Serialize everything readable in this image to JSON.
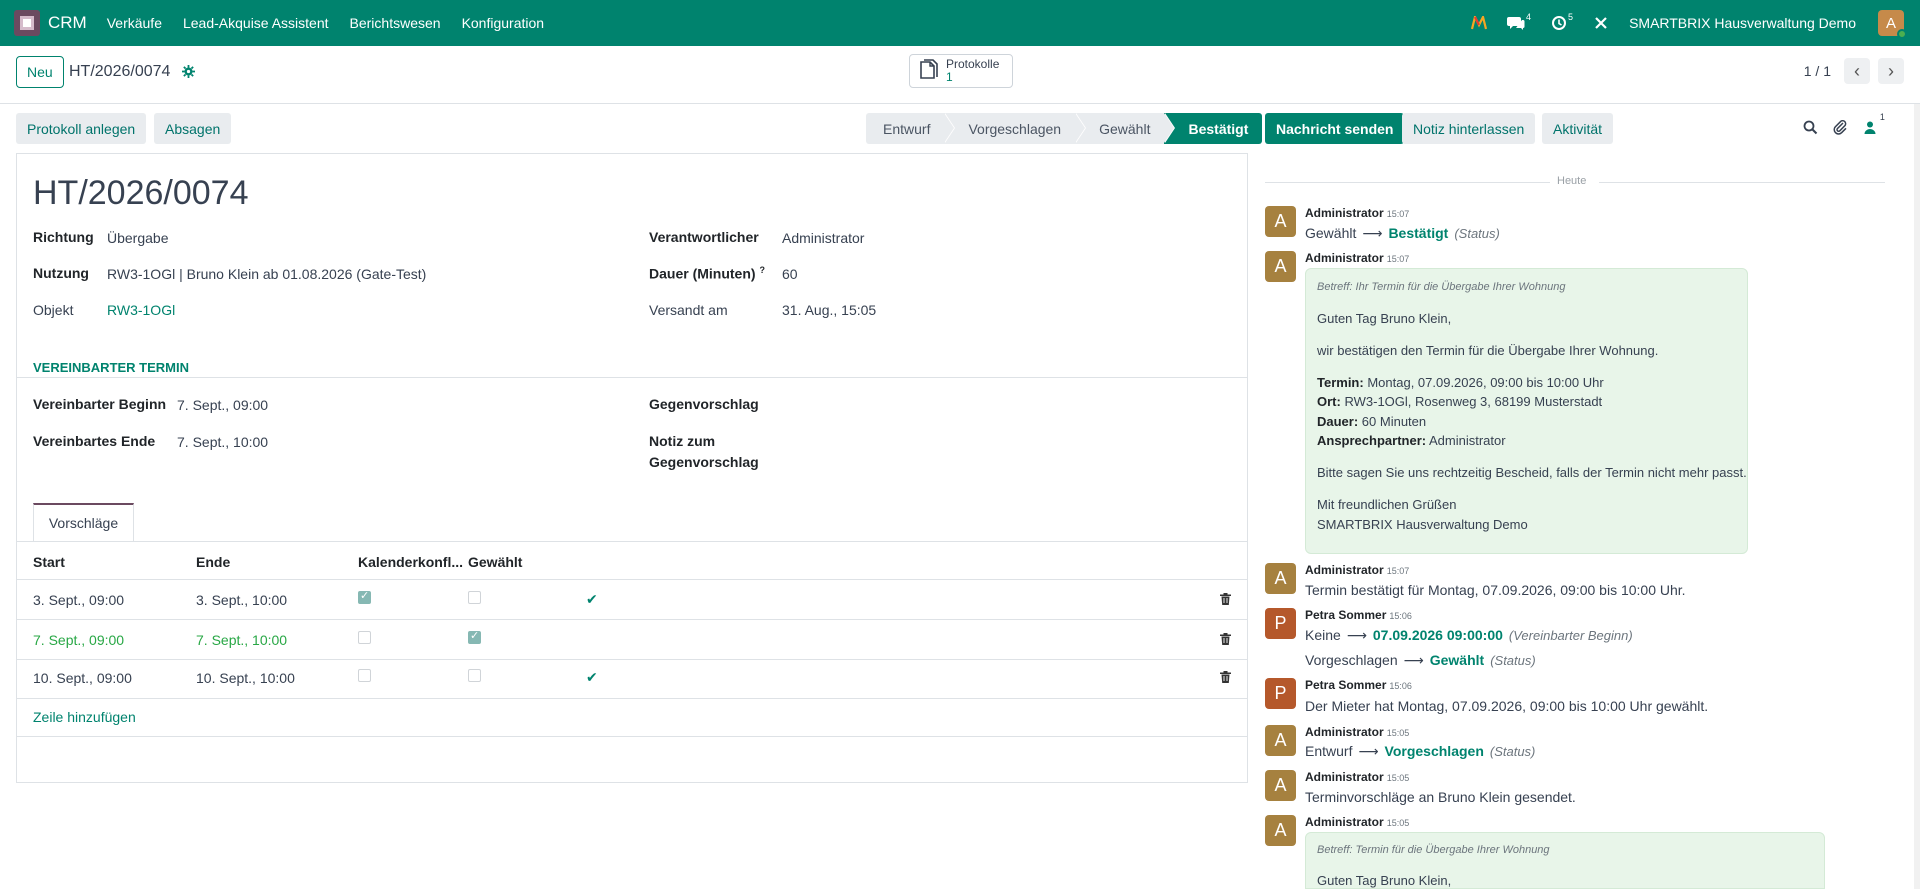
{
  "navbar": {
    "app_name": "CRM",
    "menu": [
      "Verkäufe",
      "Lead-Akquise Assistent",
      "Berichtswesen",
      "Konfiguration"
    ],
    "chat_count": "4",
    "activity_count": "5",
    "company": "SMARTBRIX Hausverwaltung Demo",
    "avatar_letter": "A"
  },
  "control": {
    "new_label": "Neu",
    "record_name": "HT/2026/0074",
    "smart_button": {
      "label": "Protokolle",
      "count": "1"
    },
    "pager": "1 / 1"
  },
  "actions": {
    "create_protocol": "Protokoll anlegen",
    "cancel": "Absagen"
  },
  "status": {
    "steps": [
      "Entwurf",
      "Vorgeschlagen",
      "Gewählt",
      "Bestätigt"
    ],
    "active": "Bestätigt"
  },
  "form": {
    "title": "HT/2026/0074",
    "richtung_label": "Richtung",
    "richtung_value": "Übergabe",
    "nutzung_label": "Nutzung",
    "nutzung_value": "RW3-1OGl | Bruno Klein ab 01.08.2026 (Gate-Test)",
    "objekt_label": "Objekt",
    "objekt_value": "RW3-1OGl",
    "verantwortlicher_label": "Verantwortlicher",
    "verantwortlicher_value": "Administrator",
    "dauer_label": "Dauer (Minuten)",
    "dauer_help": "?",
    "dauer_value": "60",
    "versandt_label": "Versandt am",
    "versandt_value": "31. Aug., 15:05",
    "section_title": "VEREINBARTER TERMIN",
    "beginn_label": "Vereinbarter Beginn",
    "beginn_value": "7. Sept., 09:00",
    "ende_label": "Vereinbartes Ende",
    "ende_value": "7. Sept., 10:00",
    "gegenvorschlag_label": "Gegenvorschlag",
    "notiz_label_1": "Notiz zum",
    "notiz_label_2": "Gegenvorschlag",
    "tab_label": "Vorschläge",
    "columns": [
      "Start",
      "Ende",
      "Kalenderkonfl...",
      "Gewählt"
    ],
    "rows": [
      {
        "start": "3. Sept., 09:00",
        "ende": "3. Sept., 10:00",
        "konflikt": true,
        "gewaehlt": false,
        "ok": true
      },
      {
        "start": "7. Sept., 09:00",
        "ende": "7. Sept., 10:00",
        "konflikt": false,
        "gewaehlt": true,
        "ok": false
      },
      {
        "start": "10. Sept., 09:00",
        "ende": "10. Sept., 10:00",
        "konflikt": false,
        "gewaehlt": false,
        "ok": true
      }
    ],
    "add_line": "Zeile hinzufügen"
  },
  "chatter": {
    "send_message": "Nachricht senden",
    "log_note": "Notiz hinterlassen",
    "activity": "Aktivität",
    "followers_count": "1",
    "today": "Heute",
    "m1": {
      "author": "Administrator",
      "time": "15:07",
      "old": "Gewählt",
      "new": "Bestätigt",
      "field": "(Status)"
    },
    "m2": {
      "author": "Administrator",
      "time": "15:07",
      "subject": "Betreff: Ihr Termin für die Übergabe Ihrer Wohnung",
      "greeting": "Guten Tag Bruno Klein,",
      "intro": "wir bestätigen den Termin für die Übergabe Ihrer Wohnung.",
      "termin_label": "Termin:",
      "termin_value": " Montag, 07.09.2026, 09:00 bis 10:00 Uhr",
      "ort_label": "Ort:",
      "ort_value": " RW3-1OGl, Rosenweg 3, 68199 Musterstadt",
      "dauer_label": "Dauer:",
      "dauer_value": " 60 Minuten",
      "ansprech_label": "Ansprechpartner:",
      "ansprech_value": " Administrator",
      "notice": "Bitte sagen Sie uns rechtzeitig Bescheid, falls der Termin nicht mehr passt.",
      "closing": "Mit freundlichen Grüßen",
      "company": "SMARTBRIX Hausverwaltung Demo"
    },
    "m3": {
      "author": "Administrator",
      "time": "15:07",
      "text": "Termin bestätigt für Montag, 07.09.2026, 09:00 bis 10:00 Uhr."
    },
    "m4": {
      "author": "Petra Sommer",
      "time": "15:06",
      "old1": "Keine",
      "new1": "07.09.2026 09:00:00",
      "field1": "(Vereinbarter Beginn)",
      "old2": "Vorgeschlagen",
      "new2": "Gewählt",
      "field2": "(Status)"
    },
    "m5": {
      "author": "Petra Sommer",
      "time": "15:06",
      "text": "Der Mieter hat Montag, 07.09.2026, 09:00 bis 10:00 Uhr gewählt."
    },
    "m6": {
      "author": "Administrator",
      "time": "15:05",
      "old": "Entwurf",
      "new": "Vorgeschlagen",
      "field": "(Status)"
    },
    "m7": {
      "author": "Administrator",
      "time": "15:05",
      "text": "Terminvorschläge an Bruno Klein gesendet."
    },
    "m8": {
      "author": "Administrator",
      "time": "15:05",
      "subject": "Betreff: Termin für die Übergabe Ihrer Wohnung",
      "greeting": "Guten Tag Bruno Klein,"
    },
    "avatar_admin": "A",
    "avatar_petra": "P"
  },
  "colors": {
    "brand": "#00836e",
    "admin_avatar": "#a6813f",
    "petra_avatar": "#b5582b"
  }
}
